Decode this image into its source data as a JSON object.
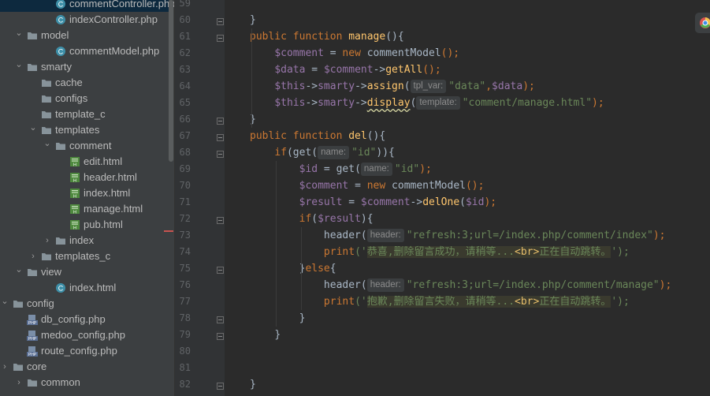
{
  "file_tree": {
    "items": [
      {
        "label": "commentController.php",
        "depth": 3,
        "kind": "php-class",
        "arrow": "none",
        "selected": true
      },
      {
        "label": "indexController.php",
        "depth": 3,
        "kind": "php-class",
        "arrow": "none"
      },
      {
        "label": "model",
        "depth": 1,
        "kind": "folder",
        "arrow": "open"
      },
      {
        "label": "commentModel.php",
        "depth": 3,
        "kind": "php-class",
        "arrow": "none"
      },
      {
        "label": "smarty",
        "depth": 1,
        "kind": "folder",
        "arrow": "open"
      },
      {
        "label": "cache",
        "depth": 2,
        "kind": "folder",
        "arrow": "none"
      },
      {
        "label": "configs",
        "depth": 2,
        "kind": "folder",
        "arrow": "none"
      },
      {
        "label": "template_c",
        "depth": 2,
        "kind": "folder",
        "arrow": "none"
      },
      {
        "label": "templates",
        "depth": 2,
        "kind": "folder",
        "arrow": "open"
      },
      {
        "label": "comment",
        "depth": 3,
        "kind": "folder",
        "arrow": "open"
      },
      {
        "label": "edit.html",
        "depth": 4,
        "kind": "html",
        "arrow": "none"
      },
      {
        "label": "header.html",
        "depth": 4,
        "kind": "html",
        "arrow": "none"
      },
      {
        "label": "index.html",
        "depth": 4,
        "kind": "html",
        "arrow": "none"
      },
      {
        "label": "manage.html",
        "depth": 4,
        "kind": "html",
        "arrow": "none"
      },
      {
        "label": "pub.html",
        "depth": 4,
        "kind": "html",
        "arrow": "none"
      },
      {
        "label": "index",
        "depth": 3,
        "kind": "folder",
        "arrow": "closed"
      },
      {
        "label": "templates_c",
        "depth": 2,
        "kind": "folder",
        "arrow": "closed"
      },
      {
        "label": "view",
        "depth": 1,
        "kind": "folder",
        "arrow": "open"
      },
      {
        "label": "index.html",
        "depth": 3,
        "kind": "php-class",
        "arrow": "none"
      },
      {
        "label": "config",
        "depth": 0,
        "kind": "folder",
        "arrow": "open"
      },
      {
        "label": "db_config.php",
        "depth": 1,
        "kind": "php",
        "arrow": "none"
      },
      {
        "label": "medoo_config.php",
        "depth": 1,
        "kind": "php",
        "arrow": "none"
      },
      {
        "label": "route_config.php",
        "depth": 1,
        "kind": "php",
        "arrow": "none"
      },
      {
        "label": "core",
        "depth": 0,
        "kind": "folder",
        "arrow": "closed"
      },
      {
        "label": "common",
        "depth": 1,
        "kind": "folder",
        "arrow": "closed"
      }
    ]
  },
  "editor": {
    "lines": [
      {
        "num": "59",
        "tokens": []
      },
      {
        "num": "60",
        "fold": "end",
        "tokens": [
          {
            "t": "}",
            "c": "pl"
          }
        ]
      },
      {
        "num": "61",
        "fold": "start",
        "tokens": [
          {
            "t": "public function ",
            "c": "kw"
          },
          {
            "t": "manage",
            "c": "fn"
          },
          {
            "t": "(){",
            "c": "pl"
          }
        ]
      },
      {
        "num": "62",
        "tokens": [
          {
            "t": "    ",
            "c": "pl"
          },
          {
            "t": "$comment",
            "c": "var"
          },
          {
            "t": " = ",
            "c": "pl"
          },
          {
            "t": "new ",
            "c": "kw"
          },
          {
            "t": "commentModel",
            "c": "pl"
          },
          {
            "t": "();",
            "c": "kw"
          }
        ]
      },
      {
        "num": "63",
        "tokens": [
          {
            "t": "    ",
            "c": "pl"
          },
          {
            "t": "$data",
            "c": "var"
          },
          {
            "t": " = ",
            "c": "pl"
          },
          {
            "t": "$comment",
            "c": "var"
          },
          {
            "t": "->",
            "c": "pl"
          },
          {
            "t": "getAll",
            "c": "fn"
          },
          {
            "t": "();",
            "c": "kw"
          }
        ]
      },
      {
        "num": "64",
        "tokens": [
          {
            "t": "    ",
            "c": "pl"
          },
          {
            "t": "$this",
            "c": "var"
          },
          {
            "t": "->",
            "c": "pl"
          },
          {
            "t": "smarty",
            "c": "var"
          },
          {
            "t": "->",
            "c": "pl"
          },
          {
            "t": "assign",
            "c": "fn"
          },
          {
            "t": "(",
            "c": "pl"
          },
          {
            "hint": "tpl_var:"
          },
          {
            "t": "\"data\"",
            "c": "str"
          },
          {
            "t": ",",
            "c": "kw"
          },
          {
            "t": "$data",
            "c": "var"
          },
          {
            "t": ");",
            "c": "kw"
          }
        ]
      },
      {
        "num": "65",
        "tokens": [
          {
            "t": "    ",
            "c": "pl"
          },
          {
            "t": "$this",
            "c": "var"
          },
          {
            "t": "->",
            "c": "pl"
          },
          {
            "t": "smarty",
            "c": "var"
          },
          {
            "t": "->",
            "c": "pl"
          },
          {
            "t": "display",
            "c": "fn wavy"
          },
          {
            "t": "(",
            "c": "pl"
          },
          {
            "hint": "template:"
          },
          {
            "t": "\"comment/manage.html\"",
            "c": "str"
          },
          {
            "t": ");",
            "c": "kw"
          }
        ]
      },
      {
        "num": "66",
        "fold": "end",
        "tokens": [
          {
            "t": "}",
            "c": "pl"
          }
        ]
      },
      {
        "num": "67",
        "fold": "start",
        "tokens": [
          {
            "t": "public function ",
            "c": "kw"
          },
          {
            "t": "del",
            "c": "fn"
          },
          {
            "t": "(){",
            "c": "pl"
          }
        ]
      },
      {
        "num": "68",
        "fold": "start",
        "tokens": [
          {
            "t": "    ",
            "c": "pl"
          },
          {
            "t": "if",
            "c": "kw"
          },
          {
            "t": "(",
            "c": "pl"
          },
          {
            "t": "get",
            "c": "pl"
          },
          {
            "t": "(",
            "c": "pl"
          },
          {
            "hint": "name:"
          },
          {
            "t": "\"id\"",
            "c": "str"
          },
          {
            "t": ")){",
            "c": "pl"
          }
        ]
      },
      {
        "num": "69",
        "tokens": [
          {
            "t": "        ",
            "c": "pl"
          },
          {
            "t": "$id",
            "c": "var"
          },
          {
            "t": " = ",
            "c": "pl"
          },
          {
            "t": "get",
            "c": "pl"
          },
          {
            "t": "(",
            "c": "pl"
          },
          {
            "hint": "name:"
          },
          {
            "t": "\"id\"",
            "c": "str"
          },
          {
            "t": ");",
            "c": "kw"
          }
        ]
      },
      {
        "num": "70",
        "tokens": [
          {
            "t": "        ",
            "c": "pl"
          },
          {
            "t": "$comment",
            "c": "var"
          },
          {
            "t": " = ",
            "c": "pl"
          },
          {
            "t": "new ",
            "c": "kw"
          },
          {
            "t": "commentModel",
            "c": "pl"
          },
          {
            "t": "();",
            "c": "kw"
          }
        ]
      },
      {
        "num": "71",
        "tokens": [
          {
            "t": "        ",
            "c": "pl"
          },
          {
            "t": "$result",
            "c": "var"
          },
          {
            "t": " = ",
            "c": "pl"
          },
          {
            "t": "$comment",
            "c": "var"
          },
          {
            "t": "->",
            "c": "pl"
          },
          {
            "t": "delOne",
            "c": "fn"
          },
          {
            "t": "(",
            "c": "pl"
          },
          {
            "t": "$id",
            "c": "var"
          },
          {
            "t": ");",
            "c": "kw"
          }
        ]
      },
      {
        "num": "72",
        "fold": "start",
        "tokens": [
          {
            "t": "        ",
            "c": "pl"
          },
          {
            "t": "if",
            "c": "kw"
          },
          {
            "t": "(",
            "c": "pl"
          },
          {
            "t": "$result",
            "c": "var"
          },
          {
            "t": "){",
            "c": "pl"
          }
        ]
      },
      {
        "num": "73",
        "tokens": [
          {
            "t": "            ",
            "c": "pl"
          },
          {
            "t": "header",
            "c": "pl"
          },
          {
            "t": "(",
            "c": "pl"
          },
          {
            "hint": "header:"
          },
          {
            "t": "\"refresh:3;url=/index.php/comment/index\"",
            "c": "str"
          },
          {
            "t": ");",
            "c": "kw"
          }
        ]
      },
      {
        "num": "74",
        "tokens": [
          {
            "t": "            ",
            "c": "pl"
          },
          {
            "t": "print",
            "c": "kw"
          },
          {
            "t": "('",
            "c": "str"
          },
          {
            "t": "恭喜,删除留言成功，请稍等...",
            "c": "str hl"
          },
          {
            "t": "<br>",
            "c": "strtag hl"
          },
          {
            "t": "正在自动跳转。",
            "c": "str hl"
          },
          {
            "t": "');",
            "c": "str"
          }
        ]
      },
      {
        "num": "75",
        "fold": "mid",
        "tokens": [
          {
            "t": "        ",
            "c": "pl"
          },
          {
            "t": "}",
            "c": "pl"
          },
          {
            "t": "else",
            "c": "kw"
          },
          {
            "t": "{",
            "c": "pl"
          }
        ]
      },
      {
        "num": "76",
        "tokens": [
          {
            "t": "            ",
            "c": "pl"
          },
          {
            "t": "header",
            "c": "pl"
          },
          {
            "t": "(",
            "c": "pl"
          },
          {
            "hint": "header:"
          },
          {
            "t": "\"refresh:3;url=/index.php/comment/manage\"",
            "c": "str"
          },
          {
            "t": ");",
            "c": "kw"
          }
        ]
      },
      {
        "num": "77",
        "tokens": [
          {
            "t": "            ",
            "c": "pl"
          },
          {
            "t": "print",
            "c": "kw"
          },
          {
            "t": "('",
            "c": "str"
          },
          {
            "t": "抱歉,删除留言失败，请稍等...",
            "c": "str hl"
          },
          {
            "t": "<br>",
            "c": "strtag hl"
          },
          {
            "t": "正在自动跳转。",
            "c": "str hl"
          },
          {
            "t": "');",
            "c": "str"
          }
        ]
      },
      {
        "num": "78",
        "fold": "end",
        "tokens": [
          {
            "t": "        ",
            "c": "pl"
          },
          {
            "t": "}",
            "c": "pl"
          }
        ]
      },
      {
        "num": "79",
        "fold": "end",
        "tokens": [
          {
            "t": "    ",
            "c": "pl"
          },
          {
            "t": "}",
            "c": "pl"
          }
        ]
      },
      {
        "num": "80",
        "tokens": []
      },
      {
        "num": "81",
        "tokens": []
      },
      {
        "num": "82",
        "fold": "end",
        "tokens": [
          {
            "t": "}",
            "c": "pl"
          }
        ]
      }
    ]
  },
  "colors": {
    "editor_bg": "#2b2b2b",
    "tree_bg": "#3c3f41",
    "gutter_bg": "#313335",
    "keyword": "#cc7832",
    "function": "#ffc66d",
    "variable": "#9876aa",
    "string": "#6a8759"
  }
}
